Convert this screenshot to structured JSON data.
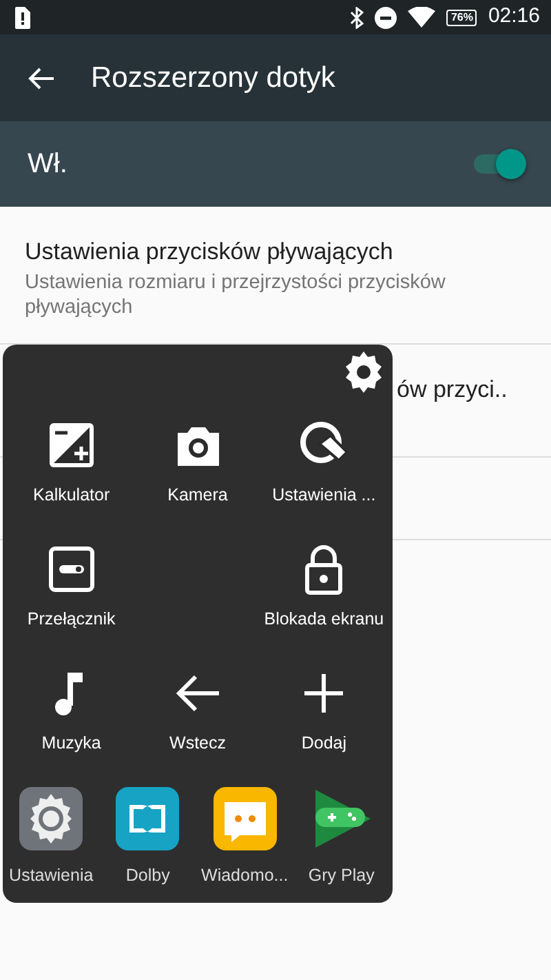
{
  "status_bar": {
    "battery": "76%",
    "time": "02:16"
  },
  "toolbar": {
    "title": "Rozszerzony dotyk"
  },
  "master_switch": {
    "label": "Wł.",
    "on": true
  },
  "settings": [
    {
      "title": "Ustawienia przycisków pływających",
      "subtitle": "Ustawienia rozmiaru i przejrzystości przycisków pływających"
    },
    {
      "title": "ów przyci.."
    }
  ],
  "floating_menu": {
    "rows": [
      [
        {
          "label": "Kalkulator"
        },
        {
          "label": "Kamera"
        },
        {
          "label": "Ustawienia ..."
        }
      ],
      [
        {
          "label": "Przełącznik"
        },
        {},
        {
          "label": "Blokada ekranu"
        }
      ],
      [
        {
          "label": "Muzyka"
        },
        {
          "label": "Wstecz"
        },
        {
          "label": "Dodaj"
        }
      ]
    ],
    "apps": [
      {
        "label": "Ustawienia"
      },
      {
        "label": "Dolby"
      },
      {
        "label": "Wiadomo..."
      },
      {
        "label": "Gry Play"
      }
    ]
  }
}
